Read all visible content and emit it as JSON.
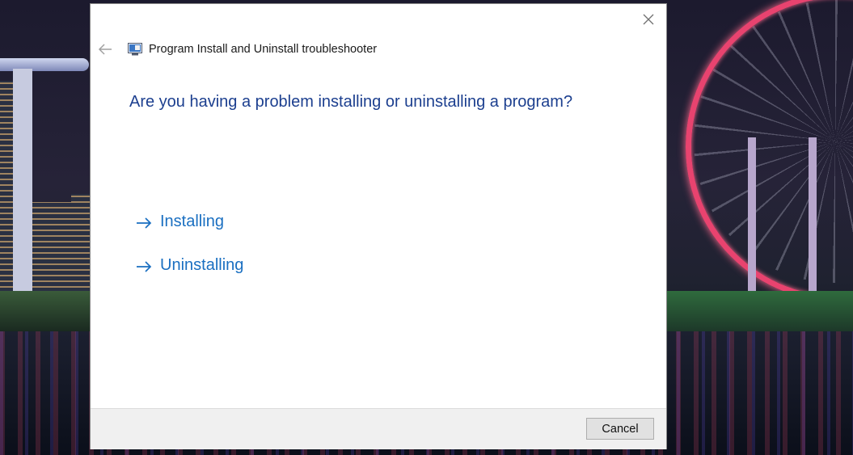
{
  "window": {
    "title": "Program Install and Uninstall troubleshooter",
    "icons": {
      "back": "back-arrow-icon",
      "close": "close-icon",
      "app": "troubleshooter-app-icon"
    }
  },
  "main": {
    "question": "Are you having a problem installing or uninstalling a program?",
    "options": [
      {
        "label": "Installing",
        "icon": "right-arrow-icon"
      },
      {
        "label": "Uninstalling",
        "icon": "right-arrow-icon"
      }
    ]
  },
  "footer": {
    "cancel_label": "Cancel"
  },
  "colors": {
    "question_text": "#1c3f8f",
    "link_text": "#1a6fc1",
    "footer_bg": "#f0f0f0"
  }
}
